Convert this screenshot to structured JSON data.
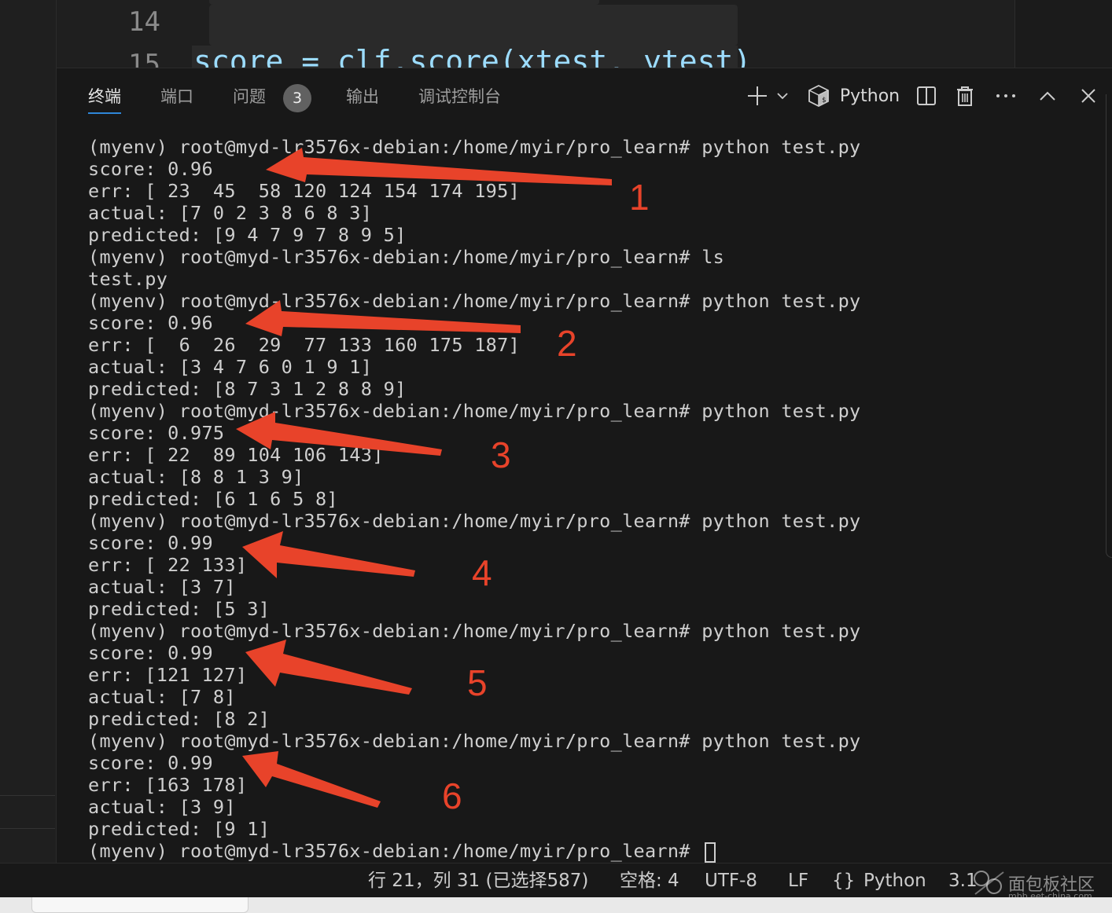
{
  "editor": {
    "line_numbers": [
      "14",
      "15"
    ],
    "partial_code": "score = clf.score(xtest, ytest)"
  },
  "panel": {
    "tabs": [
      {
        "label": "终端",
        "active": true
      },
      {
        "label": "端口",
        "active": false
      },
      {
        "label": "问题",
        "active": false
      },
      {
        "label": "输出",
        "active": false
      },
      {
        "label": "调试控制台",
        "active": false
      }
    ],
    "problems_count": "3",
    "shell_name": "Python"
  },
  "terminal": {
    "lines": [
      "(myenv) root@myd-lr3576x-debian:/home/myir/pro_learn# python test.py",
      "score: 0.96",
      "err: [ 23  45  58 120 124 154 174 195]",
      "actual: [7 0 2 3 8 6 8 3]",
      "predicted: [9 4 7 9 7 8 9 5]",
      "(myenv) root@myd-lr3576x-debian:/home/myir/pro_learn# ls",
      "test.py",
      "(myenv) root@myd-lr3576x-debian:/home/myir/pro_learn# python test.py",
      "score: 0.96",
      "err: [  6  26  29  77 133 160 175 187]",
      "actual: [3 4 7 6 0 1 9 1]",
      "predicted: [8 7 3 1 2 8 8 9]",
      "(myenv) root@myd-lr3576x-debian:/home/myir/pro_learn# python test.py",
      "score: 0.975",
      "err: [ 22  89 104 106 143]",
      "actual: [8 8 1 3 9]",
      "predicted: [6 1 6 5 8]",
      "(myenv) root@myd-lr3576x-debian:/home/myir/pro_learn# python test.py",
      "score: 0.99",
      "err: [ 22 133]",
      "actual: [3 7]",
      "predicted: [5 3]",
      "(myenv) root@myd-lr3576x-debian:/home/myir/pro_learn# python test.py",
      "score: 0.99",
      "err: [121 127]",
      "actual: [7 8]",
      "predicted: [8 2]",
      "(myenv) root@myd-lr3576x-debian:/home/myir/pro_learn# python test.py",
      "score: 0.99",
      "err: [163 178]",
      "actual: [3 9]",
      "predicted: [9 1]",
      "(myenv) root@myd-lr3576x-debian:/home/myir/pro_learn# "
    ]
  },
  "annotations": {
    "numbers": [
      "1",
      "2",
      "3",
      "4",
      "5",
      "6"
    ],
    "color": "#e8432a"
  },
  "statusbar": {
    "position": "行 21，列 31 (已选择587)",
    "indent": "空格: 4",
    "encoding": "UTF-8",
    "eol": "LF",
    "braces": "{}",
    "language": "Python",
    "version": "3.1"
  },
  "watermark": {
    "text": "面包板社区",
    "sub": "mbb.eet-china.com"
  },
  "icons": {
    "add": "plus-icon",
    "dropdown": "chevron-down-icon",
    "shell": "python-cube-icon",
    "split": "split-terminal-icon",
    "trash": "trash-icon",
    "more": "ellipsis-icon",
    "maximize": "chevron-up-icon",
    "close": "close-icon"
  }
}
